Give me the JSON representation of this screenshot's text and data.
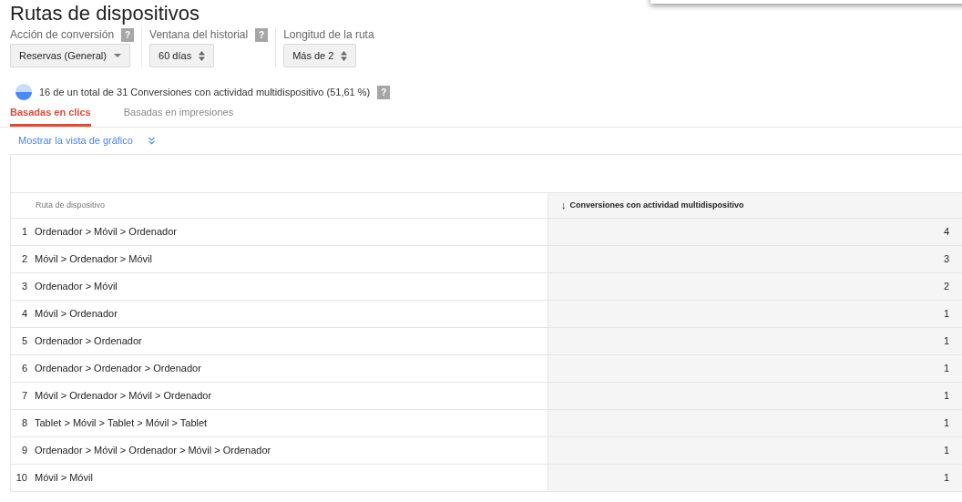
{
  "title": "Rutas de dispositivos",
  "filters": [
    {
      "label": "Acción de conversión",
      "value": "Reservas (General)",
      "kind": "dropdown",
      "help": "?"
    },
    {
      "label": "Ventana del historial",
      "value": "60 días",
      "kind": "stepper",
      "help": "?"
    },
    {
      "label": "Longitud de la ruta",
      "value": "Más de 2",
      "kind": "stepper"
    }
  ],
  "summary": {
    "text": "16 de un total de 31 Conversiones con actividad multidispositivo (51,61 %)",
    "help": "?"
  },
  "tabs": [
    {
      "label": "Basadas en clics",
      "selected": true
    },
    {
      "label": "Basadas en impresiones",
      "selected": false
    }
  ],
  "chart_toggle": {
    "label": "Mostrar la vista de gráfico",
    "expanded": false
  },
  "table": {
    "columns": [
      {
        "label": "Ruta de dispositivo",
        "sorted": false
      },
      {
        "label": "Conversiones con actividad multidispositivo",
        "sorted": true,
        "sort_indicator": "↓"
      }
    ],
    "rows": [
      {
        "index": "1",
        "path": "Ordenador > Móvil > Ordenador",
        "value": "4"
      },
      {
        "index": "2",
        "path": "Móvil > Ordenador > Móvil",
        "value": "3"
      },
      {
        "index": "3",
        "path": "Ordenador > Móvil",
        "value": "2"
      },
      {
        "index": "4",
        "path": "Móvil > Ordenador",
        "value": "1"
      },
      {
        "index": "5",
        "path": "Ordenador > Ordenador",
        "value": "1"
      },
      {
        "index": "6",
        "path": "Ordenador > Ordenador > Ordenador",
        "value": "1"
      },
      {
        "index": "7",
        "path": "Móvil > Ordenador > Móvil > Ordenador",
        "value": "1"
      },
      {
        "index": "8",
        "path": "Tablet > Móvil > Tablet > Móvil > Tablet",
        "value": "1"
      },
      {
        "index": "9",
        "path": "Ordenador > Móvil > Ordenador > Móvil > Ordenador",
        "value": "1"
      },
      {
        "index": "10",
        "path": "Móvil > Móvil",
        "value": "1"
      }
    ]
  }
}
